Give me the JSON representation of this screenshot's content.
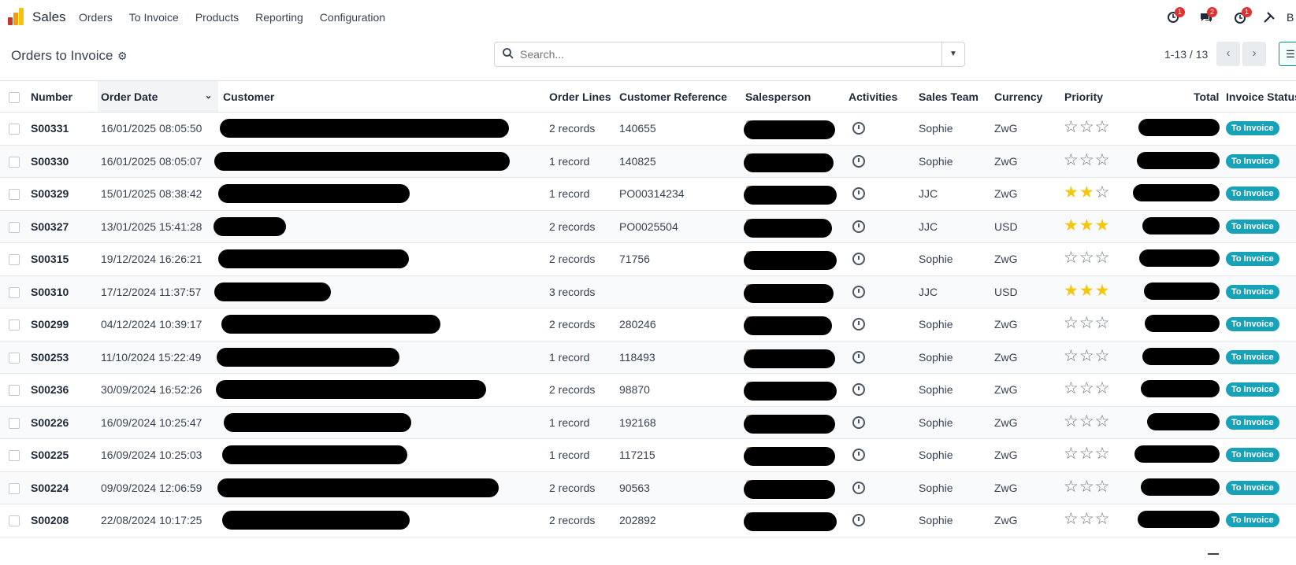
{
  "nav": {
    "app_name": "Sales",
    "menu": [
      "Orders",
      "To Invoice",
      "Products",
      "Reporting",
      "Configuration"
    ],
    "badges": {
      "activity": "1",
      "messages": "2",
      "clock": "1"
    },
    "user_initial": "B"
  },
  "control": {
    "breadcrumb": "Orders to Invoice",
    "search_placeholder": "Search...",
    "pager": "1-13 / 13"
  },
  "table": {
    "headers": [
      "Number",
      "Order Date",
      "Customer",
      "Order Lines",
      "Customer Reference",
      "Salesperson",
      "Activities",
      "Sales Team",
      "Currency",
      "Priority",
      "Total",
      "Invoice Status"
    ],
    "rows": [
      {
        "number": "S00331",
        "date": "16/01/2025 08:05:50",
        "lines": "2 records",
        "ref": "140655",
        "team": "Sophie",
        "currency": "ZwG",
        "priority": 0,
        "status": "To Invoice"
      },
      {
        "number": "S00330",
        "date": "16/01/2025 08:05:07",
        "lines": "1 record",
        "ref": "140825",
        "team": "Sophie",
        "currency": "ZwG",
        "priority": 0,
        "status": "To Invoice"
      },
      {
        "number": "S00329",
        "date": "15/01/2025 08:38:42",
        "lines": "1 record",
        "ref": "PO00314234",
        "team": "JJC",
        "currency": "ZwG",
        "priority": 2,
        "status": "To Invoice"
      },
      {
        "number": "S00327",
        "date": "13/01/2025 15:41:28",
        "lines": "2 records",
        "ref": "PO0025504",
        "team": "JJC",
        "currency": "USD",
        "priority": 3,
        "status": "To Invoice"
      },
      {
        "number": "S00315",
        "date": "19/12/2024 16:26:21",
        "lines": "2 records",
        "ref": "71756",
        "team": "Sophie",
        "currency": "ZwG",
        "priority": 0,
        "status": "To Invoice"
      },
      {
        "number": "S00310",
        "date": "17/12/2024 11:37:57",
        "lines": "3 records",
        "ref": "",
        "team": "JJC",
        "currency": "USD",
        "priority": 3,
        "status": "To Invoice"
      },
      {
        "number": "S00299",
        "date": "04/12/2024 10:39:17",
        "lines": "2 records",
        "ref": "280246",
        "team": "Sophie",
        "currency": "ZwG",
        "priority": 0,
        "status": "To Invoice"
      },
      {
        "number": "S00253",
        "date": "11/10/2024 15:22:49",
        "lines": "1 record",
        "ref": "118493",
        "team": "Sophie",
        "currency": "ZwG",
        "priority": 0,
        "status": "To Invoice"
      },
      {
        "number": "S00236",
        "date": "30/09/2024 16:52:26",
        "lines": "2 records",
        "ref": "98870",
        "team": "Sophie",
        "currency": "ZwG",
        "priority": 0,
        "status": "To Invoice"
      },
      {
        "number": "S00226",
        "date": "16/09/2024 10:25:47",
        "lines": "1 record",
        "ref": "192168",
        "team": "Sophie",
        "currency": "ZwG",
        "priority": 0,
        "status": "To Invoice"
      },
      {
        "number": "S00225",
        "date": "16/09/2024 10:25:03",
        "lines": "1 record",
        "ref": "117215",
        "team": "Sophie",
        "currency": "ZwG",
        "priority": 0,
        "status": "To Invoice"
      },
      {
        "number": "S00224",
        "date": "09/09/2024 12:06:59",
        "lines": "2 records",
        "ref": "90563",
        "team": "Sophie",
        "currency": "ZwG",
        "priority": 0,
        "status": "To Invoice"
      },
      {
        "number": "S00208",
        "date": "22/08/2024 10:17:25",
        "lines": "2 records",
        "ref": "202892",
        "team": "Sophie",
        "currency": "ZwG",
        "priority": 0,
        "status": "To Invoice"
      }
    ]
  },
  "colors": {
    "status_badge": "#17a2b8",
    "star_on": "#f3c613",
    "badge": "#e03131"
  }
}
